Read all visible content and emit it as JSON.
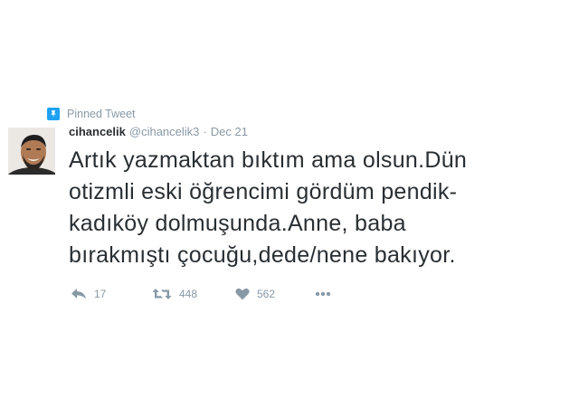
{
  "pinned": {
    "label": "Pinned Tweet",
    "icon": "pin-icon"
  },
  "tweet": {
    "author_name": "cihancelik",
    "handle": "@cihancelik3",
    "separator": "·",
    "date": "Dec 21",
    "text_lines": [
      "Artık yazmaktan bıktım ama olsun.Dün",
      "otizmli eski öğrencimi gördüm pendik-",
      "kadıköy dolmuşunda.Anne, baba",
      "bırakmıştı çocuğu,dede/nene bakıyor."
    ]
  },
  "actions": {
    "reply": {
      "icon": "reply-icon",
      "count": "17"
    },
    "retweet": {
      "icon": "retweet-icon",
      "count": "448"
    },
    "like": {
      "icon": "heart-icon",
      "count": "562"
    },
    "more": {
      "icon": "more-icon"
    }
  },
  "colors": {
    "accent": "#1da1f2",
    "text": "#292f33",
    "muted": "#8899a6"
  }
}
